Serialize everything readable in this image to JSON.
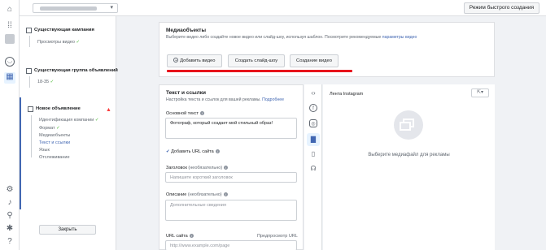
{
  "topbar": {
    "account_blurred": "",
    "quick_create_label": "Режим быстрого создания"
  },
  "rail": {
    "icons": [
      "home-icon",
      "grid-icon",
      "account-icon",
      "smile-icon",
      "table-icon",
      "settings-icon",
      "bell-icon",
      "search-icon",
      "bug-icon",
      "question-icon"
    ]
  },
  "sidebar": {
    "campaign": {
      "title": "Существующая кампания",
      "sub": "Просмотры видео"
    },
    "adset": {
      "title": "Существующая группа объявлений",
      "sub": "18-35"
    },
    "newad": {
      "title": "Новое объявление",
      "items": [
        "Идентификация компании",
        "Формат",
        "Медиаобъекты",
        "Текст и ссылки",
        "Язык",
        "Отслеживание"
      ]
    },
    "close_label": "Закрыть"
  },
  "media": {
    "title": "Медиаобъекты",
    "subtitle": "Выберите видео либо создайте новое видео или слайд-шоу, используя шаблон. Посмотрите рекомендуемые",
    "subtitle_link": "параметры видео",
    "buttons": [
      "Добавить видео",
      "Создать слайд-шоу",
      "Создание видео"
    ]
  },
  "text": {
    "title": "Текст и ссылки",
    "subtitle": "Настройка текста и ссылок для вашей рекламы.",
    "subtitle_link": "Подробнее",
    "primary_label": "Основной текст",
    "primary_value": "Фотограф, который создает мой стильный образ!",
    "add_url_label": "Добавить URL сайта",
    "headline_label": "Заголовок",
    "headline_opt": "(необязательно)",
    "headline_placeholder": "Напишите короткий заголовок",
    "desc_label": "Описание",
    "desc_opt": "(необязательно)",
    "desc_placeholder": "Дополнительные сведения",
    "url_label": "URL сайта",
    "url_right": "Предпросмотр URL",
    "url_placeholder": "http://www.example.com/page"
  },
  "preview": {
    "feed_label": "Лента Instagram",
    "select_media_text": "Выберите медиафайл для рекламы"
  },
  "colors": {
    "accent": "#4267b2",
    "highlight_line": "#e8141c",
    "warning": "#fa3e3e"
  }
}
